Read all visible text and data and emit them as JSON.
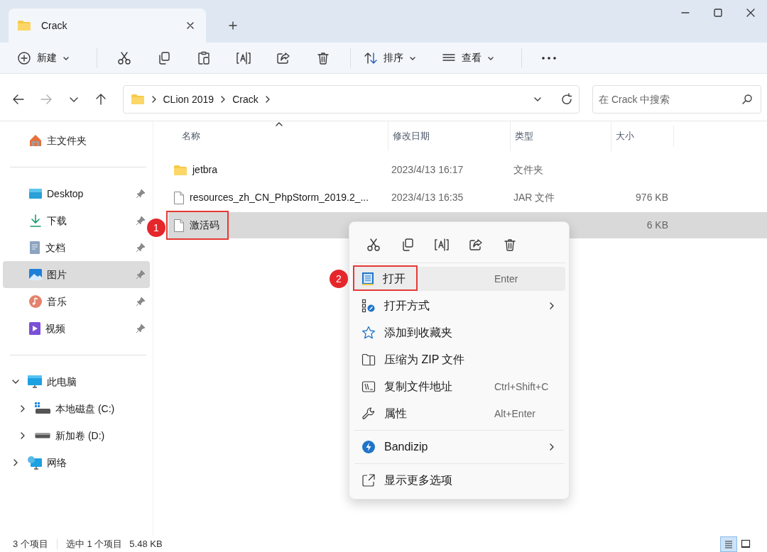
{
  "window": {
    "tab_title": "Crack"
  },
  "toolbar": {
    "items": [
      {
        "kind": "new",
        "label": "新建",
        "dropdown": true
      },
      {
        "kind": "separator"
      },
      {
        "kind": "cut"
      },
      {
        "kind": "copy"
      },
      {
        "kind": "paste"
      },
      {
        "kind": "rename"
      },
      {
        "kind": "share"
      },
      {
        "kind": "delete"
      },
      {
        "kind": "separator"
      },
      {
        "kind": "sort",
        "label": "排序",
        "dropdown": true
      },
      {
        "kind": "view",
        "label": "查看",
        "dropdown": true
      },
      {
        "kind": "separator"
      },
      {
        "kind": "more"
      }
    ]
  },
  "navigation": [
    {
      "kind": "back",
      "disabled": false
    },
    {
      "kind": "forward",
      "disabled": true
    },
    {
      "kind": "recent",
      "disabled": false
    },
    {
      "kind": "up",
      "disabled": false
    }
  ],
  "breadcrumb": [
    "CLion 2019",
    "Crack"
  ],
  "search": {
    "placeholder": "在 Crack 中搜索"
  },
  "sidebar": {
    "home": {
      "label": "主文件夹",
      "selected": false
    },
    "quick_access": [
      {
        "kind": "desktop",
        "label": "Desktop",
        "pinned": true,
        "selected": false
      },
      {
        "kind": "downloads",
        "label": "下载",
        "pinned": true,
        "selected": false
      },
      {
        "kind": "documents",
        "label": "文档",
        "pinned": true,
        "selected": false
      },
      {
        "kind": "pictures",
        "label": "图片",
        "pinned": true,
        "selected": true
      },
      {
        "kind": "music",
        "label": "音乐",
        "pinned": true,
        "selected": false
      },
      {
        "kind": "videos",
        "label": "视频",
        "pinned": true,
        "selected": false
      }
    ],
    "tree": [
      {
        "kind": "pc",
        "label": "此电脑",
        "expanded": true,
        "children": [
          {
            "kind": "system_drive",
            "label": "本地磁盘 (C:)",
            "expanded": false
          },
          {
            "kind": "drive",
            "label": "新加卷 (D:)",
            "expanded": false
          }
        ]
      },
      {
        "kind": "network",
        "label": "网络",
        "expanded": false
      }
    ]
  },
  "table": {
    "columns": [
      {
        "label": "名称",
        "sorted": true
      },
      {
        "label": "修改日期",
        "sorted": false
      },
      {
        "label": "类型",
        "sorted": false
      },
      {
        "label": "大小",
        "sorted": false
      }
    ],
    "rows": [
      {
        "kind": "folder",
        "name": "jetbra",
        "modified": "2023/4/13 16:17",
        "type": "文件夹",
        "selected": false
      },
      {
        "kind": "file",
        "name": "resources_zh_CN_PhpStorm_2019.2_...",
        "modified": "2023/4/13 16:35",
        "type": "JAR 文件",
        "size": "976 KB",
        "selected": false
      },
      {
        "kind": "file",
        "name": "激活码",
        "size": "6 KB",
        "selected": true,
        "annotation": "1"
      }
    ]
  },
  "context_menu": {
    "quick_actions": [
      {
        "kind": "cut"
      },
      {
        "kind": "copy"
      },
      {
        "kind": "rename"
      },
      {
        "kind": "share"
      },
      {
        "kind": "delete"
      }
    ],
    "items": [
      {
        "kind": "notepad",
        "label": "打开",
        "shortcut": "Enter",
        "submenu": false,
        "selected": true,
        "annotation": "2"
      },
      {
        "kind": "open_with",
        "label": "打开方式",
        "submenu": true,
        "selected": false
      },
      {
        "kind": "star",
        "label": "添加到收藏夹",
        "submenu": false,
        "selected": false
      },
      {
        "kind": "zip",
        "label": "压缩为 ZIP 文件",
        "submenu": false,
        "selected": false
      },
      {
        "kind": "path",
        "label": "复制文件地址",
        "shortcut": "Ctrl+Shift+C",
        "submenu": false,
        "selected": false
      },
      {
        "kind": "wrench",
        "label": "属性",
        "shortcut": "Alt+Enter",
        "submenu": false,
        "selected": false
      },
      {
        "kind": "separator"
      },
      {
        "kind": "bandizip",
        "label": "Bandizip",
        "submenu": true,
        "selected": false
      },
      {
        "kind": "separator"
      },
      {
        "kind": "more_options",
        "label": "显示更多选项",
        "submenu": false,
        "selected": false
      }
    ]
  },
  "status_bar": {
    "item_count": "3 个项目",
    "selection": "选中 1 个项目",
    "selection_size": "5.48 KB",
    "views": [
      {
        "kind": "details",
        "selected": true
      },
      {
        "kind": "tiles",
        "selected": false
      }
    ]
  }
}
